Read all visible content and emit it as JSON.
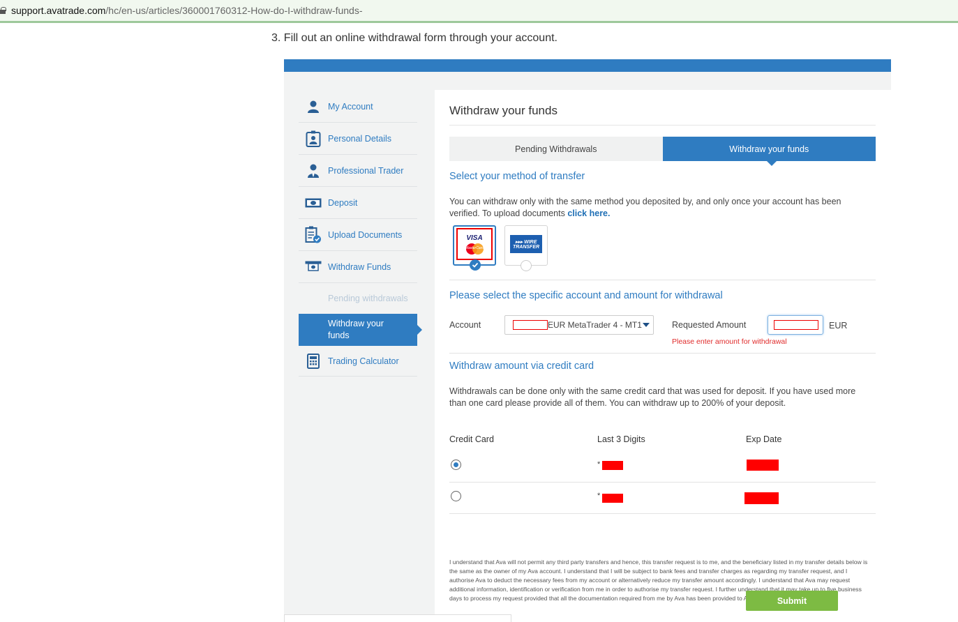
{
  "browser": {
    "url_host": "support.avatrade.com",
    "url_path": "/hc/en-us/articles/360001760312-How-do-I-withdraw-funds-"
  },
  "article": {
    "step_text": "3. Fill out an online withdrawal form through your account."
  },
  "sidebar": {
    "items": [
      {
        "label": "My Account",
        "icon": "user-icon"
      },
      {
        "label": "Personal Details",
        "icon": "id-card-icon"
      },
      {
        "label": "Professional Trader",
        "icon": "professional-icon"
      },
      {
        "label": "Deposit",
        "icon": "cash-icon"
      },
      {
        "label": "Upload Documents",
        "icon": "upload-document-icon"
      },
      {
        "label": "Withdraw Funds",
        "icon": "withdraw-icon"
      }
    ],
    "sub_pending": "Pending withdrawals",
    "sub_active": "Withdraw your funds",
    "calculator": "Trading Calculator"
  },
  "main": {
    "title": "Withdraw your funds",
    "tabs": [
      "Pending Withdrawals",
      "Withdraw your funds"
    ],
    "method_heading": "Select your method of transfer",
    "method_text": "You can withdraw only with the same method you deposited by, and only once your account has been verified. To upload documents ",
    "method_link": "click here.",
    "methods": [
      {
        "label_top": "VISA",
        "label_bottom": "MasterCard",
        "selected": true
      },
      {
        "label_top": "▸▸▸ WIRE",
        "label_bottom": "TRANSFER",
        "selected": false
      }
    ],
    "account_heading": "Please select the specific account and amount for withdrawal",
    "account_label": "Account",
    "account_value": "EUR MetaTrader 4 - MT1",
    "amount_label": "Requested Amount",
    "currency": "EUR",
    "amount_error": "Please enter amount for withdrawal",
    "cc_heading": "Withdraw amount via credit card",
    "cc_text": "Withdrawals can be done only with the same credit card that was used for deposit. If you have used more than one card please provide all of them. You can withdraw up to 200% of your deposit.",
    "columns": [
      "Credit Card",
      "Last 3 Digits",
      "Exp Date"
    ],
    "cards": [
      {
        "selected": true,
        "digits_prefix": "*"
      },
      {
        "selected": false,
        "digits_prefix": "*"
      }
    ],
    "disclaimer": "I understand that Ava will not permit any third party transfers and hence, this transfer request is to me, and the beneficiary listed in my transfer details below is the same as the owner of my Ava account. I understand that I will be subject to bank fees and transfer charges as regarding my transfer request, and I authorise Ava to deduct the necessary fees from my account or alternatively reduce my transfer amount accordingly. I understand that Ava may request additional information, identification or verification from me in order to authorise my transfer request. I further understand that it may take up to five business days to process my request provided that all the documentation required from me by Ava has been provided to Ava's satisfaction.",
    "submit": "Submit"
  },
  "colors": {
    "brand_blue": "#2f7cc1",
    "submit_green": "#7dbb43",
    "error_red": "#e02b2b",
    "redaction_red": "#ff0000"
  }
}
